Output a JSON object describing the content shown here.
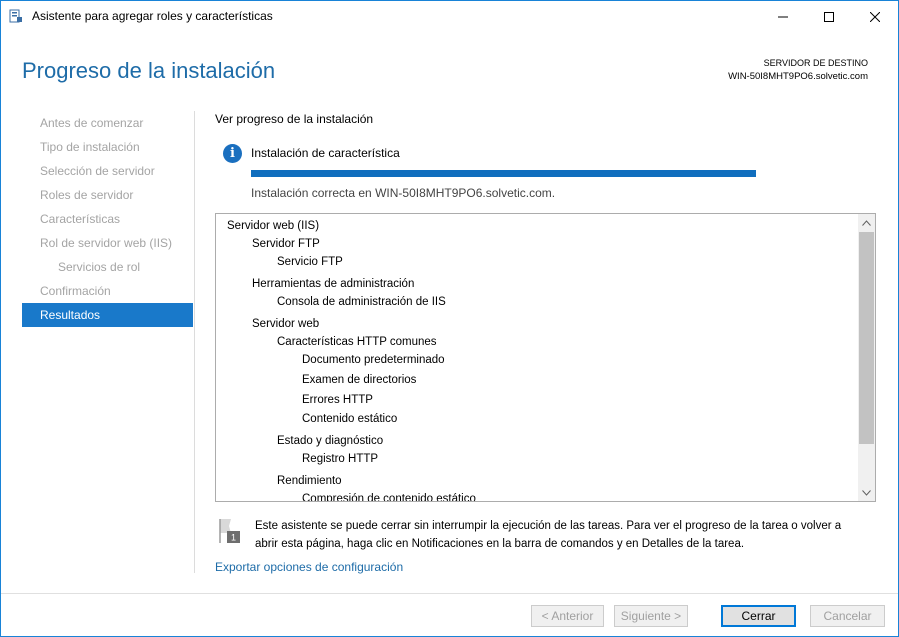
{
  "window": {
    "title": "Asistente para agregar roles y características"
  },
  "header": {
    "page_title": "Progreso de la instalación",
    "destination_label": "SERVIDOR DE DESTINO",
    "destination_server": "WIN-50I8MHT9PO6.solvetic.com"
  },
  "sidebar": {
    "items": [
      {
        "label": "Antes de comenzar"
      },
      {
        "label": "Tipo de instalación"
      },
      {
        "label": "Selección de servidor"
      },
      {
        "label": "Roles de servidor"
      },
      {
        "label": "Características"
      },
      {
        "label": "Rol de servidor web (IIS)"
      },
      {
        "label": "Servicios de rol"
      },
      {
        "label": "Confirmación"
      },
      {
        "label": "Resultados"
      }
    ]
  },
  "main": {
    "section_heading": "Ver progreso de la instalación",
    "status_text": "Instalación de característica",
    "progress_fraction": 1.0,
    "result_text": "Instalación correcta en WIN-50I8MHT9PO6.solvetic.com.",
    "tree": [
      {
        "level": 0,
        "text": "Servidor web (IIS)"
      },
      {
        "level": 1,
        "text": "Servidor FTP"
      },
      {
        "level": 2,
        "text": "Servicio FTP"
      },
      {
        "level": 1,
        "text": "Herramientas de administración"
      },
      {
        "level": 2,
        "text": "Consola de administración de IIS"
      },
      {
        "level": 1,
        "text": "Servidor web"
      },
      {
        "level": 2,
        "text": "Características HTTP comunes"
      },
      {
        "level": 3,
        "text": "Documento predeterminado"
      },
      {
        "level": 3,
        "text": "Examen de directorios"
      },
      {
        "level": 3,
        "text": "Errores HTTP"
      },
      {
        "level": 3,
        "text": "Contenido estático"
      },
      {
        "level": 2,
        "text": "Estado y diagnóstico"
      },
      {
        "level": 3,
        "text": "Registro HTTP"
      },
      {
        "level": 2,
        "text": "Rendimiento"
      },
      {
        "level": 3,
        "text": "Compresión de contenido estático"
      }
    ],
    "notice_badge": "1",
    "notice_text": "Este asistente se puede cerrar sin interrumpir la ejecución de las tareas. Para ver el progreso de la tarea o volver a abrir esta página, haga clic en Notificaciones en la barra de comandos y en Detalles de la tarea.",
    "export_link": "Exportar opciones de configuración"
  },
  "footer": {
    "prev_label": "< Anterior",
    "next_label": "Siguiente >",
    "close_label": "Cerrar",
    "cancel_label": "Cancelar"
  },
  "colors": {
    "accent": "#1979ca",
    "title": "#1e6ca8",
    "progress": "#106ebe"
  }
}
